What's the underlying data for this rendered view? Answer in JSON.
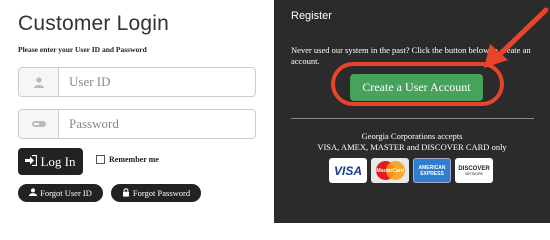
{
  "login": {
    "title": "Customer Login",
    "instructions": "Please enter your User ID and Password",
    "user_placeholder": "User ID",
    "password_placeholder": "Password",
    "login_label": "Log In",
    "remember_label": "Remember me",
    "forgot_user_label": "Forgot User ID",
    "forgot_password_label": "Forgot Password"
  },
  "register": {
    "title": "Register",
    "text": "Never used our system in the past? Click the button below to create an account.",
    "button_label": "Create a User Account",
    "accept_line1": "Georgia Corporations accepts",
    "accept_line2": "VISA, AMEX, MASTER and DISCOVER CARD only"
  },
  "cards": {
    "visa": "VISA",
    "mastercard": "MasterCard",
    "amex_line1": "AMERICAN",
    "amex_line2": "EXPRESS",
    "discover": "DISCOVER",
    "discover_sub": "NETWORK"
  },
  "colors": {
    "dark_panel": "#2b2b2b",
    "button_dark": "#222222",
    "create_green": "#47a35c",
    "highlight_red": "#e8432b"
  }
}
